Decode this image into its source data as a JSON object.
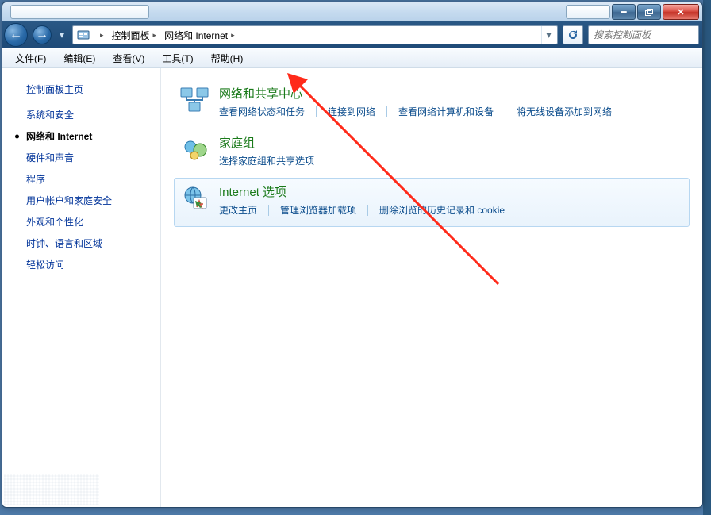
{
  "breadcrumb": [
    {
      "label": "控制面板"
    },
    {
      "label": "网络和 Internet"
    }
  ],
  "search": {
    "placeholder": "搜索控制面板"
  },
  "menubar": [
    {
      "label": "文件(F)"
    },
    {
      "label": "编辑(E)"
    },
    {
      "label": "查看(V)"
    },
    {
      "label": "工具(T)"
    },
    {
      "label": "帮助(H)"
    }
  ],
  "sidebar": {
    "home": "控制面板主页",
    "items": [
      {
        "label": "系统和安全"
      },
      {
        "label": "网络和 Internet",
        "active": true
      },
      {
        "label": "硬件和声音"
      },
      {
        "label": "程序"
      },
      {
        "label": "用户帐户和家庭安全"
      },
      {
        "label": "外观和个性化"
      },
      {
        "label": "时钟、语言和区域"
      },
      {
        "label": "轻松访问"
      }
    ]
  },
  "categories": [
    {
      "icon": "network-sharing-icon",
      "title": "网络和共享中心",
      "links": [
        "查看网络状态和任务",
        "连接到网络",
        "查看网络计算机和设备",
        "将无线设备添加到网络"
      ]
    },
    {
      "icon": "homegroup-icon",
      "title": "家庭组",
      "links": [
        "选择家庭组和共享选项"
      ]
    },
    {
      "icon": "internet-options-icon",
      "title": "Internet 选项",
      "links": [
        "更改主页",
        "管理浏览器加载项",
        "删除浏览的历史记录和 cookie"
      ],
      "selected": true
    }
  ]
}
